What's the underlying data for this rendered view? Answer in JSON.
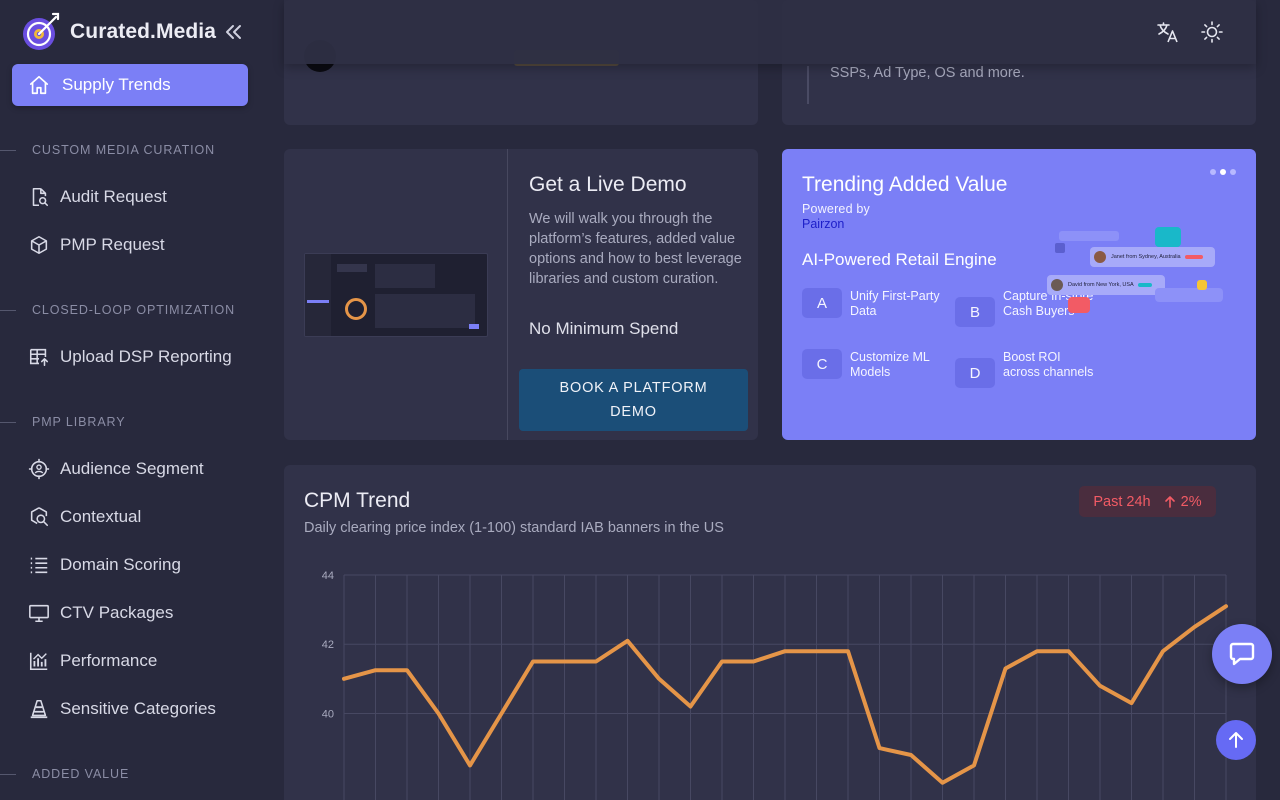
{
  "brand": {
    "name": "Curated.Media"
  },
  "sidebar": {
    "active_item": {
      "label": "Supply Trends",
      "icon": "home-icon"
    },
    "sections": [
      {
        "label": "CUSTOM MEDIA CURATION"
      },
      {
        "label": "CLOSED-LOOP OPTIMIZATION"
      },
      {
        "label": "PMP LIBRARY"
      },
      {
        "label": "ADDED VALUE"
      }
    ],
    "items": [
      {
        "label": "Audit Request",
        "icon": "document-search-icon"
      },
      {
        "label": "PMP Request",
        "icon": "cube-icon"
      },
      {
        "label": "Upload DSP Reporting",
        "icon": "table-upload-icon"
      },
      {
        "label": "Audience Segment",
        "icon": "audience-target-icon"
      },
      {
        "label": "Contextual",
        "icon": "contextual-search-icon"
      },
      {
        "label": "Domain Scoring",
        "icon": "list-icon"
      },
      {
        "label": "CTV Packages",
        "icon": "tv-icon"
      },
      {
        "label": "Performance",
        "icon": "performance-chart-icon"
      },
      {
        "label": "Sensitive Categories",
        "icon": "cone-icon"
      }
    ]
  },
  "topbar": {
    "icons": [
      "translate-icon",
      "theme-toggle-icon"
    ]
  },
  "top_right_card": {
    "text": "SSPs, Ad Type, OS and more."
  },
  "demo": {
    "title": "Get a Live Demo",
    "description": "We will walk you through the platform’s features, added value options and how to best leverage libraries and custom curation.",
    "spend": "No Minimum Spend",
    "button_line1": "BOOK A PLATFORM",
    "button_line2": "DEMO"
  },
  "trending": {
    "title": "Trending Added Value",
    "powered_by": "Powered by",
    "partner": "Pairzon",
    "engine": "AI-Powered Retail Engine",
    "steps": [
      {
        "letter": "A",
        "text": "Unify First-Party Data"
      },
      {
        "letter": "B",
        "text": "Capture In-store Cash Buyers"
      },
      {
        "letter": "C",
        "text": "Customize ML Models"
      },
      {
        "letter": "D",
        "text": "Boost ROI across channels"
      }
    ],
    "illustration": {
      "card1": "Janet from Sydney, Australia",
      "card2": "David from New York, USA"
    },
    "accent": "#7b7ff6"
  },
  "chart": {
    "title": "CPM Trend",
    "subtitle": "Daily clearing price index (1-100) standard IAB banners in the US",
    "badge_period": "Past 24h",
    "badge_change": "2%",
    "badge_color": "#f25b65",
    "line_color": "#e59548"
  },
  "chart_data": {
    "type": "line",
    "title": "CPM Trend",
    "ytick_labels": [
      "40",
      "42",
      "44"
    ],
    "ylim": [
      37.5,
      44
    ],
    "grid": true,
    "series": [
      {
        "values": [
          41,
          41.25,
          41.25,
          40,
          38.5,
          40,
          41.5,
          41.5,
          41.5,
          42.1,
          41,
          40.2,
          41.5,
          41.5,
          41.8,
          41.8,
          41.8,
          39,
          38.8,
          38,
          38.5,
          41.3,
          41.8,
          41.8,
          40.8,
          40.3,
          41.8,
          42.5,
          43.1
        ]
      }
    ]
  }
}
